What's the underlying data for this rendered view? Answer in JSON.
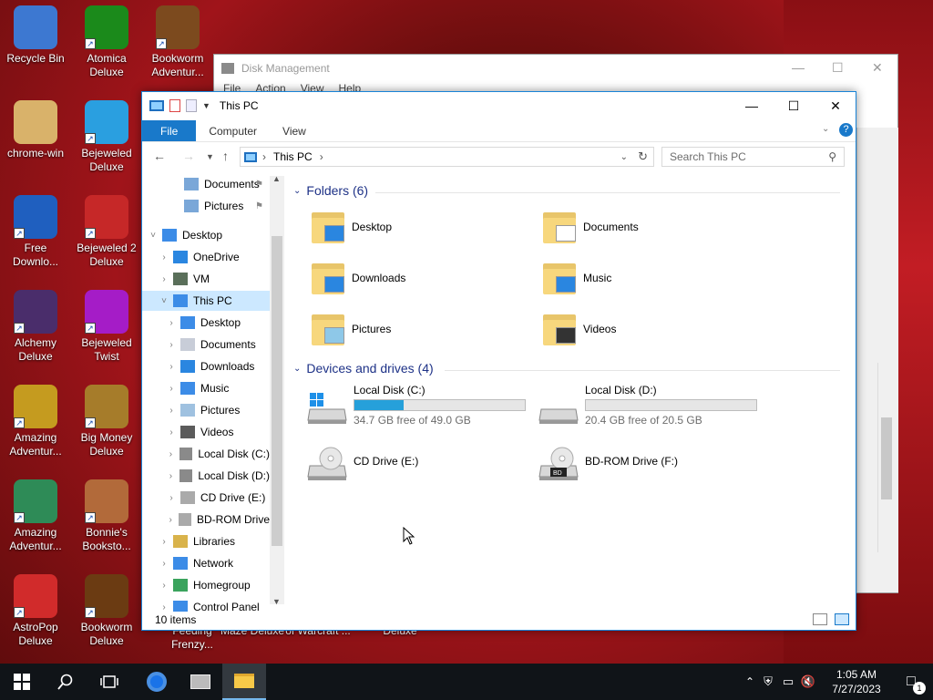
{
  "desktop": {
    "icons": [
      {
        "label": "Recycle Bin",
        "icon": "recycle-bin-icon"
      },
      {
        "label": "Atomica\nDeluxe",
        "icon": "atomica-icon"
      },
      {
        "label": "Bookworm\nAdventur...",
        "icon": "bookworm-icon"
      },
      {
        "label": "chrome-win",
        "icon": "folder-icon"
      },
      {
        "label": "Bejeweled\nDeluxe",
        "icon": "bejeweled-icon"
      },
      {
        "label": "Free\nDownlo...",
        "icon": "free-download-icon"
      },
      {
        "label": "Bejeweled 2\nDeluxe",
        "icon": "bejeweled2-icon"
      },
      {
        "label": "Alchemy\nDeluxe",
        "icon": "alchemy-icon"
      },
      {
        "label": "Bejeweled\nTwist",
        "icon": "bejeweled-twist-icon"
      },
      {
        "label": "Amazing\nAdventur...",
        "icon": "amazing-adventures-icon"
      },
      {
        "label": "Big Money\nDeluxe",
        "icon": "big-money-icon"
      },
      {
        "label": "Amazing\nAdventur...",
        "icon": "amazing-adventures2-icon"
      },
      {
        "label": "Bonnie's\nBooksto...",
        "icon": "bonnies-bookstore-icon"
      },
      {
        "label": "AstroPop\nDeluxe",
        "icon": "astropop-icon"
      },
      {
        "label": "Bookworm\nDeluxe",
        "icon": "bookworm-deluxe-icon"
      }
    ],
    "hidden_labels": [
      "Feeding\nFrenzy...",
      "Maze Deluxe",
      "of Warcraft ...",
      "Deluxe"
    ]
  },
  "disk_management": {
    "title": "Disk Management",
    "menu": [
      "File",
      "Action",
      "View",
      "Help"
    ]
  },
  "explorer": {
    "title": "This PC",
    "tabs": {
      "file": "File",
      "computer": "Computer",
      "view": "View"
    },
    "address": {
      "location": "This PC"
    },
    "search": {
      "placeholder": "Search This PC"
    },
    "nav": {
      "items": [
        {
          "label": "Documents",
          "pinned": true
        },
        {
          "label": "Pictures",
          "pinned": true
        },
        {
          "label": "Desktop",
          "expanded": true
        },
        {
          "label": "OneDrive"
        },
        {
          "label": "VM"
        },
        {
          "label": "This PC",
          "expanded": true,
          "selected": true
        },
        {
          "label": "Desktop"
        },
        {
          "label": "Documents"
        },
        {
          "label": "Downloads"
        },
        {
          "label": "Music"
        },
        {
          "label": "Pictures"
        },
        {
          "label": "Videos"
        },
        {
          "label": "Local Disk (C:)"
        },
        {
          "label": "Local Disk (D:)"
        },
        {
          "label": "CD Drive (E:)"
        },
        {
          "label": "BD-ROM Drive"
        },
        {
          "label": "Libraries"
        },
        {
          "label": "Network"
        },
        {
          "label": "Homegroup"
        },
        {
          "label": "Control Panel"
        }
      ]
    },
    "folders_header": "Folders (6)",
    "folders": [
      {
        "label": "Desktop",
        "icon": "desktop-folder-icon"
      },
      {
        "label": "Documents",
        "icon": "documents-folder-icon"
      },
      {
        "label": "Downloads",
        "icon": "downloads-folder-icon"
      },
      {
        "label": "Music",
        "icon": "music-folder-icon"
      },
      {
        "label": "Pictures",
        "icon": "pictures-folder-icon"
      },
      {
        "label": "Videos",
        "icon": "videos-folder-icon"
      }
    ],
    "drives_header": "Devices and drives (4)",
    "drives": [
      {
        "label": "Local Disk (C:)",
        "free": "34.7 GB free of 49.0 GB",
        "used_fraction": 0.29,
        "icon": "windows-drive-icon"
      },
      {
        "label": "Local Disk (D:)",
        "free": "20.4 GB free of 20.5 GB",
        "used_fraction": 0.0,
        "icon": "hard-drive-icon"
      },
      {
        "label": "CD Drive (E:)",
        "icon": "cd-drive-icon"
      },
      {
        "label": "BD-ROM Drive (F:)",
        "icon": "bd-rom-drive-icon"
      }
    ],
    "status": "10 items"
  },
  "taskbar": {
    "clock_time": "1:05 AM",
    "clock_date": "7/27/2023",
    "notification_count": "1"
  },
  "colors": {
    "accent": "#1979ca",
    "selection": "#cce8ff",
    "drive_bar_fill": "#26a0da",
    "group_header": "#1e3287"
  }
}
